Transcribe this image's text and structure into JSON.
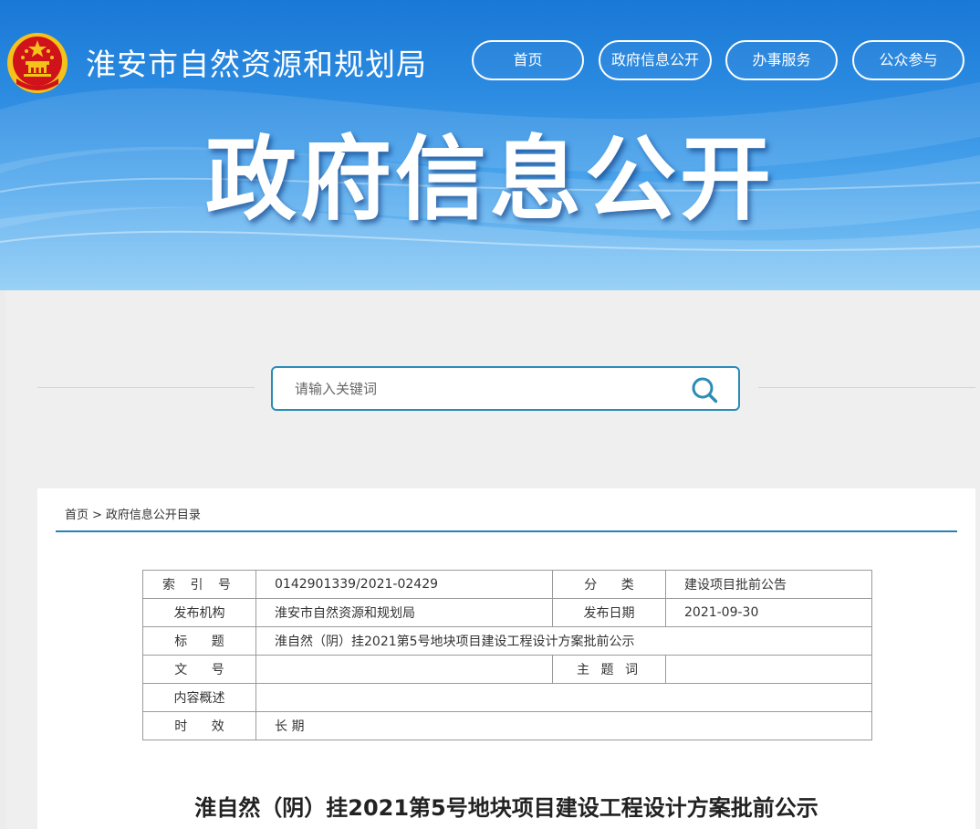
{
  "header": {
    "site_title": "淮安市自然资源和规划局",
    "hero_title": "政府信息公开",
    "nav": [
      {
        "label": "首页"
      },
      {
        "label": "政府信息公开"
      },
      {
        "label": "办事服务"
      },
      {
        "label": "公众参与"
      }
    ]
  },
  "search": {
    "placeholder": "请输入关键词",
    "icon": "search-icon"
  },
  "breadcrumb": {
    "home": "首页",
    "separator": ">",
    "current": "政府信息公开目录"
  },
  "meta": {
    "index_label": "索 引 号",
    "index_value": "0142901339/2021-02429",
    "category_label": "分 类",
    "category_value": "建设项目批前公告",
    "publisher_label": "发布机构",
    "publisher_value": "淮安市自然资源和规划局",
    "date_label": "发布日期",
    "date_value": "2021-09-30",
    "title_label": "标 题",
    "title_value": "淮自然（阴）挂2021第5号地块项目建设工程设计方案批前公示",
    "doc_no_label": "文 号",
    "doc_no_value": "",
    "subject_label": "主 题 词",
    "subject_value": "",
    "summary_label": "内容概述",
    "summary_value": "",
    "validity_label": "时 效",
    "validity_value": "长 期"
  },
  "article": {
    "title": "淮自然（阴）挂2021第5号地块项目建设工程设计方案批前公示"
  },
  "colors": {
    "banner_top": "#1a78d6",
    "banner_bottom": "#86c8f5",
    "accent": "#2c8cb6",
    "rule": "#2a7fb8",
    "emblem_red": "#d0121b",
    "emblem_gold": "#f5c21a"
  }
}
